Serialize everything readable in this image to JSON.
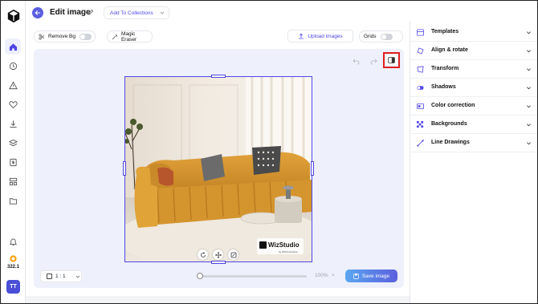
{
  "header": {
    "title": "Edit image",
    "collections_label": "Add To Collections"
  },
  "sidebar": {
    "credits": "322.1",
    "avatar_initials": "TT",
    "nav_icons": [
      "home-icon",
      "history-icon",
      "warning-icon",
      "heart-icon",
      "download-icon",
      "layers-icon",
      "dollar-icon",
      "grid-icon",
      "folder-icon"
    ],
    "accent_color": "#4f46e5"
  },
  "toolbar": {
    "remove_bg_label": "Remove Bg",
    "remove_bg_enabled": false,
    "magic_eraser_label": "Magic Eraser",
    "upload_label": "Upload images",
    "grids_label": "Grids",
    "grids_enabled": false
  },
  "canvas": {
    "watermark": "WizStudio",
    "watermark_sub": "by WizCommerce",
    "ratio_label": "1 : 1",
    "zoom_value": "100%",
    "zoom_reset": "×",
    "zoom_fraction": 0.0,
    "save_label": "Save image"
  },
  "panel": {
    "items": [
      {
        "label": "Templates",
        "icon": "template-icon"
      },
      {
        "label": "Align & rotate",
        "icon": "rotate-icon"
      },
      {
        "label": "Transform",
        "icon": "transform-icon"
      },
      {
        "label": "Shadows",
        "icon": "shadow-icon"
      },
      {
        "label": "Color correction",
        "icon": "color-correction-icon"
      },
      {
        "label": "Backgrounds",
        "icon": "backgrounds-icon"
      },
      {
        "label": "Line Drawings",
        "icon": "line-drawing-icon"
      }
    ]
  }
}
